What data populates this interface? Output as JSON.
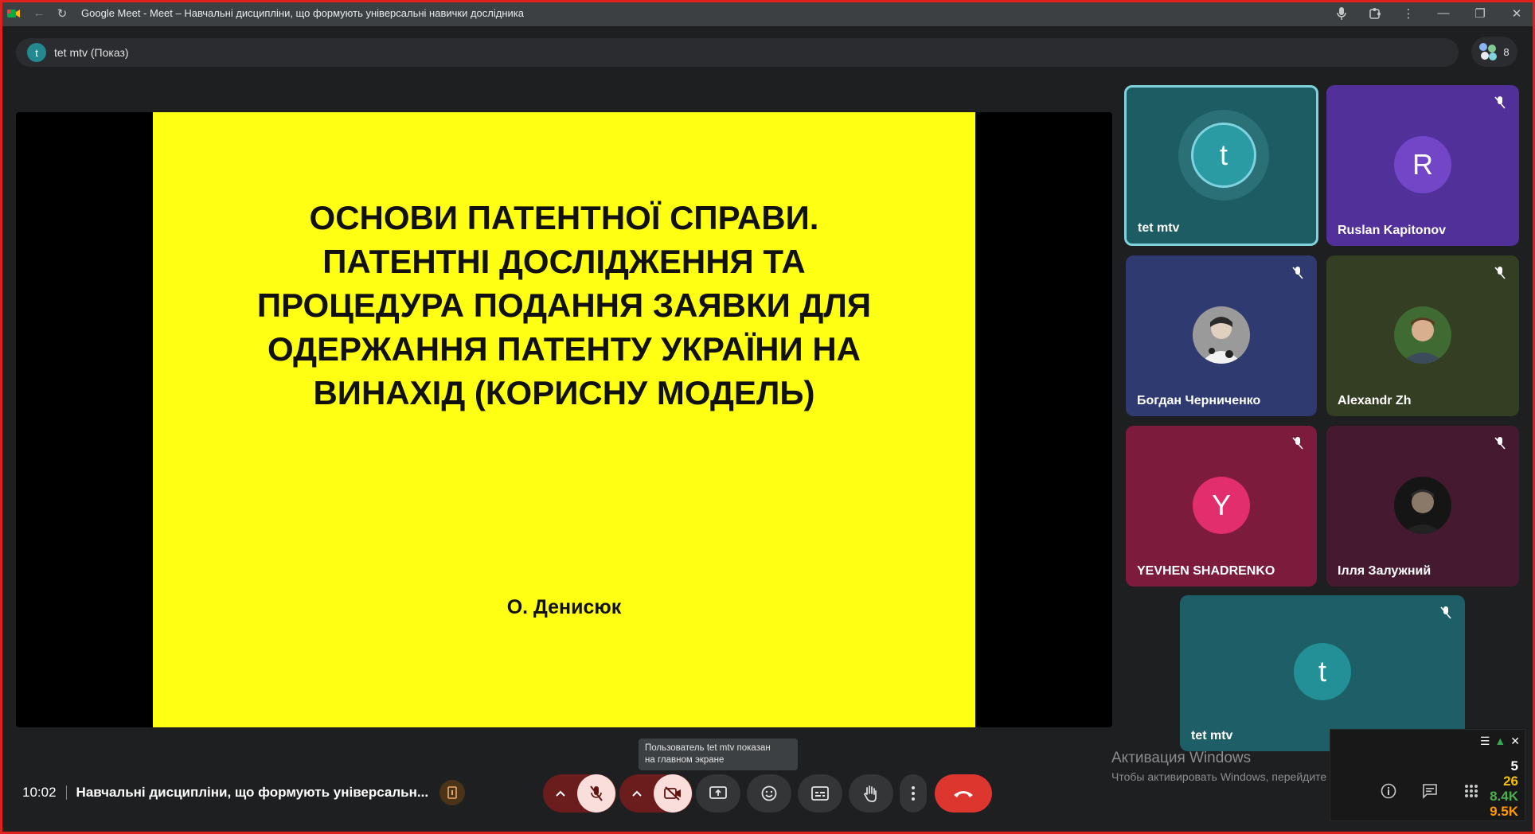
{
  "browser": {
    "tab_title": "Google Meet - Meet – Навчальні дисципліни, що формують універсальні навички дослідника"
  },
  "pinned": {
    "avatar_letter": "t",
    "label": "tet mtv (Показ)"
  },
  "people_count": "8",
  "slide": {
    "title_lines": [
      "ОСНОВИ ПАТЕНТНОЇ СПРАВИ.",
      "ПАТЕНТНІ ДОСЛІДЖЕННЯ ТА",
      "ПРОЦЕДУРА ПОДАННЯ ЗАЯВКИ ДЛЯ",
      "ОДЕРЖАННЯ ПАТЕНТУ УКРАЇНИ НА",
      "ВИНАХІД (КОРИСНУ МОДЕЛЬ)"
    ],
    "author": "О. Денисюк"
  },
  "participants": [
    {
      "name": "tet mtv",
      "letter": "t",
      "color": "#1e7f86",
      "muted": false,
      "active": true
    },
    {
      "name": "Ruslan Kapitonov",
      "letter": "R",
      "color": "#6a3fb0",
      "muted": true
    },
    {
      "name": "Богдан Черниченко",
      "letter": "",
      "color": "#3a4a8c",
      "muted": true
    },
    {
      "name": "Alexandr Zh",
      "letter": "",
      "color": "#3b4628",
      "muted": true
    },
    {
      "name": "YEVHEN SHADRENKO",
      "letter": "Y",
      "color": "#e32e6e",
      "muted": true
    },
    {
      "name": "Ілля Залужний",
      "letter": "",
      "color": "#4a1c35",
      "muted": true
    },
    {
      "name": "tet mtv",
      "letter": "t",
      "color": "#239097",
      "muted": true
    }
  ],
  "tooltip": {
    "line1": "Пользователь tet mtv показан",
    "line2": "на главном экране"
  },
  "meeting": {
    "time": "10:02",
    "name": "Навчальні дисципліни, що формують універсальн..."
  },
  "windows_watermark": {
    "line1": "Активация Windows",
    "line2": "Чтобы активировать Windows, перейдите в раздел \"Параметры\"."
  },
  "overlay_stats": [
    "5",
    "26",
    "8.4K",
    "9.5K"
  ],
  "colors": {
    "accent": "#8ab4f8",
    "end_call": "#dc362e",
    "slide_bg": "#ffff14",
    "active_border": "#7fd3df"
  }
}
